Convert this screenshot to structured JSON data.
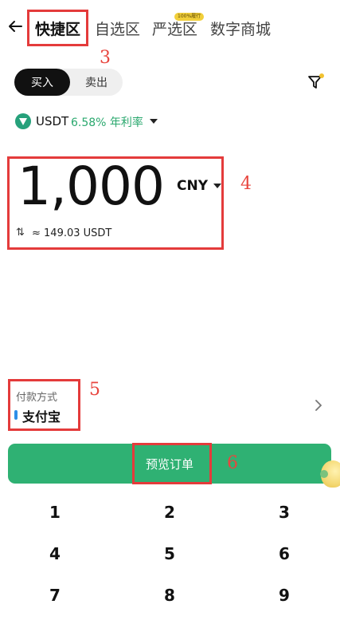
{
  "nav": {
    "tabs": [
      {
        "label": "快捷区"
      },
      {
        "label": "自选区"
      },
      {
        "label": "严选区"
      },
      {
        "label": "数字商城"
      }
    ],
    "badge": "100%履行"
  },
  "trade": {
    "buy_label": "买入",
    "sell_label": "卖出"
  },
  "coin": {
    "name": "USDT",
    "rate": "6.58% 年利率"
  },
  "amount": {
    "value": "1,000",
    "currency": "CNY",
    "conversion": "≈ 149.03 USDT"
  },
  "payment": {
    "label": "付款方式",
    "value": "支付宝"
  },
  "actions": {
    "preview": "预览订单"
  },
  "annotations": [
    "3",
    "4",
    "5",
    "6"
  ],
  "keypad": [
    "1",
    "2",
    "3",
    "4",
    "5",
    "6",
    "7",
    "8",
    "9"
  ]
}
